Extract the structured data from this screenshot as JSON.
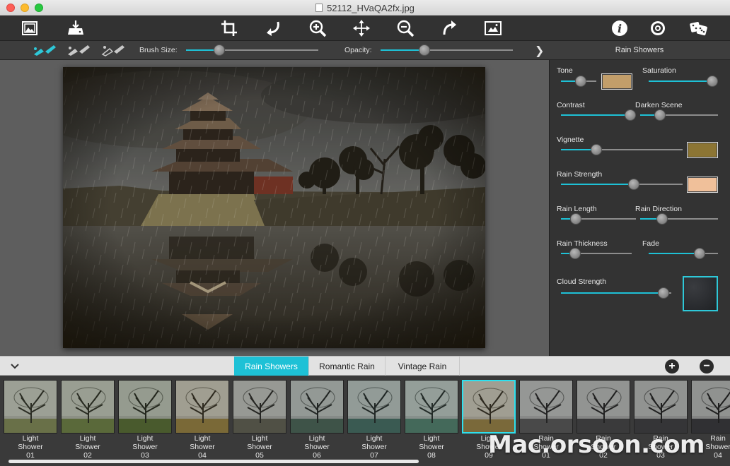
{
  "window": {
    "title": "52112_HVaQA2fx.jpg"
  },
  "toolbar": {
    "left_icons": [
      "open-image-icon",
      "save-export-icon"
    ],
    "center_icons": [
      "crop-icon",
      "undo-icon",
      "zoom-in-icon",
      "move-icon",
      "zoom-out-icon",
      "redo-icon",
      "compare-image-icon"
    ],
    "right_icons": [
      "info-icon",
      "settings-icon",
      "random-dice-icon"
    ]
  },
  "subbar": {
    "brush_size_label": "Brush Size:",
    "brush_size_value": 0.25,
    "opacity_label": "Opacity:",
    "opacity_value": 0.33,
    "panel_title": "Rain Showers"
  },
  "accent_color": "#1ec1d6",
  "controls": {
    "tone": {
      "label": "Tone",
      "value": 0.55,
      "swatch": "#c29e6a"
    },
    "saturation": {
      "label": "Saturation",
      "value": 0.92
    },
    "contrast": {
      "label": "Contrast",
      "value": 0.92
    },
    "darken_scene": {
      "label": "Darken Scene",
      "value": 0.25
    },
    "vignette": {
      "label": "Vignette",
      "value": 0.29,
      "swatch": "#8c7534"
    },
    "rain_strength": {
      "label": "Rain Strength",
      "value": 0.6,
      "swatch": "#f0c09a"
    },
    "rain_length": {
      "label": "Rain Length",
      "value": 0.2
    },
    "rain_direction": {
      "label": "Rain Direction",
      "value": 0.28
    },
    "rain_thickness": {
      "label": "Rain Thickness",
      "value": 0.2
    },
    "fade": {
      "label": "Fade",
      "value": 0.73
    },
    "cloud_strength": {
      "label": "Cloud Strength",
      "value": 0.93
    }
  },
  "tabs": [
    {
      "label": "Rain Showers",
      "active": true
    },
    {
      "label": "Romantic Rain",
      "active": false
    },
    {
      "label": "Vintage Rain",
      "active": false
    }
  ],
  "presets": [
    {
      "line1": "Light",
      "line2": "Shower",
      "line3": "01"
    },
    {
      "line1": "Light",
      "line2": "Shower",
      "line3": "02"
    },
    {
      "line1": "Light",
      "line2": "Shower",
      "line3": "03"
    },
    {
      "line1": "Light",
      "line2": "Shower",
      "line3": "04"
    },
    {
      "line1": "Light",
      "line2": "Shower",
      "line3": "05"
    },
    {
      "line1": "Light",
      "line2": "Shower",
      "line3": "06"
    },
    {
      "line1": "Light",
      "line2": "Shower",
      "line3": "07"
    },
    {
      "line1": "Light",
      "line2": "Shower",
      "line3": "08"
    },
    {
      "line1": "Light",
      "line2": "Shower",
      "line3": "09",
      "selected": true
    },
    {
      "line1": "Rain",
      "line2": "Shower",
      "line3": "01"
    },
    {
      "line1": "Rain",
      "line2": "Shower",
      "line3": "02"
    },
    {
      "line1": "Rain",
      "line2": "Shower",
      "line3": "03"
    },
    {
      "line1": "Rain",
      "line2": "Shower",
      "line3": "04"
    }
  ],
  "watermark": "Mac.orsoon.com"
}
